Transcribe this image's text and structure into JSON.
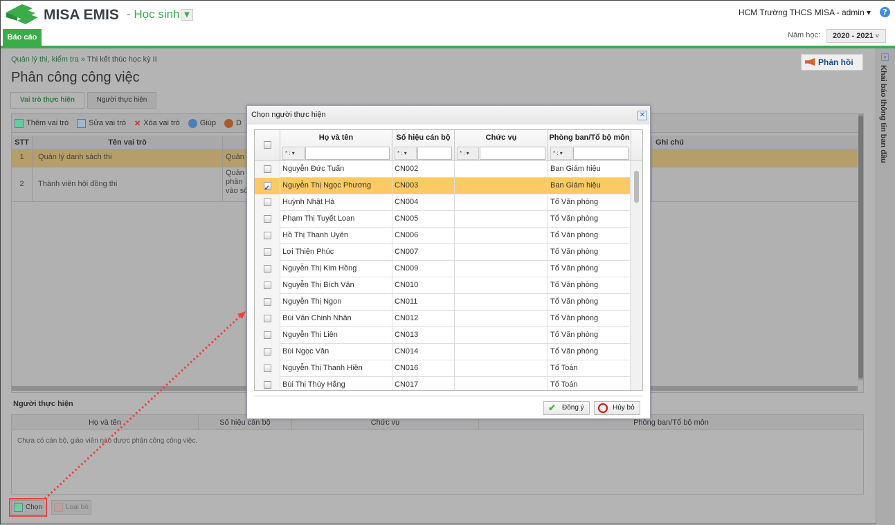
{
  "header": {
    "brand": "MISA EMIS",
    "module": "- Học sinh",
    "user": "HCM Trường THCS MISA - admin ▾",
    "help": "?",
    "tab_report": "Báo cáo",
    "year_label": "Năm học:",
    "year_value": "2020 - 2021"
  },
  "sidebar": {
    "collapse": "«",
    "title": "Khai báo thông tin ban đầu"
  },
  "breadcrumb": {
    "parent": "Quản lý thi, kiểm tra",
    "sep": " » ",
    "current": "Thi kết thúc học kỳ II"
  },
  "page_title": "Phân công công việc",
  "feedback": "Phản hồi",
  "tabs": [
    "Vai trò thực hiện",
    "Người thực hiện"
  ],
  "toolbar": {
    "add": "Thêm vai trò",
    "edit": "Sửa vai trò",
    "delete": "Xóa vai trò",
    "help": "Giúp",
    "more": "D"
  },
  "roles_grid": {
    "columns": [
      "STT",
      "Tên vai trò",
      "",
      "Ghi chú"
    ],
    "rows": [
      {
        "stt": "1",
        "name": "Quản lý danh sách thi",
        "desc": "Quản"
      },
      {
        "stt": "2",
        "name": "Thành viên hội đồng thi",
        "desc": "Quản\nphân\nvào số"
      }
    ]
  },
  "assignees": {
    "label": "Người thực hiện",
    "columns": [
      "Họ và tên",
      "Số hiệu cán bộ",
      "Chức vụ",
      "Phòng ban/Tổ bộ môn"
    ],
    "empty": "Chưa có cán bộ, giáo viên nào được phân công công việc."
  },
  "buttons": {
    "choose": "Chọn",
    "remove": "Loại bỏ"
  },
  "dialog": {
    "title": "Chọn người thực hiện",
    "close": "✕",
    "columns": [
      "Họ và tên",
      "Số hiệu cán bộ",
      "Chức vụ",
      "Phòng ban/Tổ bộ môn"
    ],
    "filter_op": "* : ▾",
    "rows": [
      {
        "name": "Nguyễn Đức Tuấn",
        "code": "CN002",
        "position": "",
        "dept": "Ban Giám hiệu",
        "checked": false
      },
      {
        "name": "Nguyễn Thị Ngọc Phương",
        "code": "CN003",
        "position": "",
        "dept": "Ban Giám hiệu",
        "checked": true
      },
      {
        "name": "Huỳnh Nhật Hà",
        "code": "CN004",
        "position": "",
        "dept": "Tổ Văn phòng",
        "checked": false
      },
      {
        "name": "Phạm Thị Tuyết Loan",
        "code": "CN005",
        "position": "",
        "dept": "Tổ Văn phòng",
        "checked": false
      },
      {
        "name": "Hồ Thị Thanh Uyên",
        "code": "CN006",
        "position": "",
        "dept": "Tổ Văn phòng",
        "checked": false
      },
      {
        "name": "Lợi Thiện Phúc",
        "code": "CN007",
        "position": "",
        "dept": "Tổ Văn phòng",
        "checked": false
      },
      {
        "name": "Nguyễn Thị Kim Hồng",
        "code": "CN009",
        "position": "",
        "dept": "Tổ Văn phòng",
        "checked": false
      },
      {
        "name": "Nguyễn Thị Bích Vân",
        "code": "CN010",
        "position": "",
        "dept": "Tổ Văn phòng",
        "checked": false
      },
      {
        "name": "Nguyễn Thị Ngon",
        "code": "CN011",
        "position": "",
        "dept": "Tổ Văn phòng",
        "checked": false
      },
      {
        "name": "Bùi Văn Chinh Nhân",
        "code": "CN012",
        "position": "",
        "dept": "Tổ Văn phòng",
        "checked": false
      },
      {
        "name": "Nguyễn Thị Liên",
        "code": "CN013",
        "position": "",
        "dept": "Tổ Văn phòng",
        "checked": false
      },
      {
        "name": "Bùi Ngọc Vân",
        "code": "CN014",
        "position": "",
        "dept": "Tổ Văn phòng",
        "checked": false
      },
      {
        "name": "Nguyễn Thị Thanh Hiền",
        "code": "CN016",
        "position": "",
        "dept": "Tổ Toán",
        "checked": false
      },
      {
        "name": "Bùi Thị Thúy Hằng",
        "code": "CN017",
        "position": "",
        "dept": "Tổ Toán",
        "checked": false
      }
    ],
    "ok": "Đồng ý",
    "cancel": "Hủy bỏ"
  },
  "colors": {
    "brand_green": "#3aac4a",
    "selected_row": "#fdc964",
    "annotation_red": "#f04040"
  }
}
